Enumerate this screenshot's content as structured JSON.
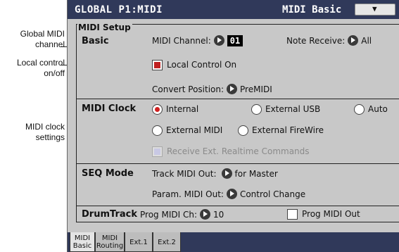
{
  "callouts": {
    "global_midi_channel": "Global MIDI channel",
    "local_control": "Local control on/off",
    "midi_clock_settings": "MIDI clock settings"
  },
  "header": {
    "title": "GLOBAL P1:MIDI",
    "page": "MIDI Basic",
    "menu_glyph": "▼"
  },
  "setup": {
    "label": "MIDI Setup",
    "basic": {
      "section": "Basic",
      "midi_channel_label": "MIDI Channel:",
      "midi_channel_value": "01",
      "note_receive_label": "Note Receive:",
      "note_receive_value": "All",
      "local_control_label": "Local Control On",
      "local_control_checked": true,
      "convert_position_label": "Convert Position:",
      "convert_position_value": "PreMIDI"
    },
    "midi_clock": {
      "section": "MIDI Clock",
      "options": [
        "Internal",
        "External USB",
        "Auto",
        "External MIDI",
        "External FireWire"
      ],
      "selected": "Internal",
      "receive_ext_label": "Receive Ext. Realtime Commands"
    },
    "seq_mode": {
      "section": "SEQ Mode",
      "track_midi_out_label": "Track MIDI Out:",
      "track_midi_out_value": "for Master",
      "param_midi_out_label": "Param. MIDI Out:",
      "param_midi_out_value": "Control Change"
    },
    "drum_track": {
      "section": "DrumTrack",
      "prog_midi_ch_label": "Prog MIDI Ch:",
      "prog_midi_ch_value": "10",
      "prog_midi_out_label": "Prog MIDI Out",
      "prog_midi_out_checked": false
    }
  },
  "tabs": [
    {
      "line1": "MIDI",
      "line2": "Basic"
    },
    {
      "line1": "MIDI",
      "line2": "Routing"
    },
    {
      "line1": "Ext.1",
      "line2": ""
    },
    {
      "line1": "Ext.2",
      "line2": ""
    }
  ],
  "colors": {
    "title_bar": "#30395a",
    "panel": "#c8c8c8",
    "selected_indicator": "#d02020"
  },
  "icons": {
    "arrow": "arrow-right-circle-icon",
    "menu": "chevron-down-icon"
  }
}
